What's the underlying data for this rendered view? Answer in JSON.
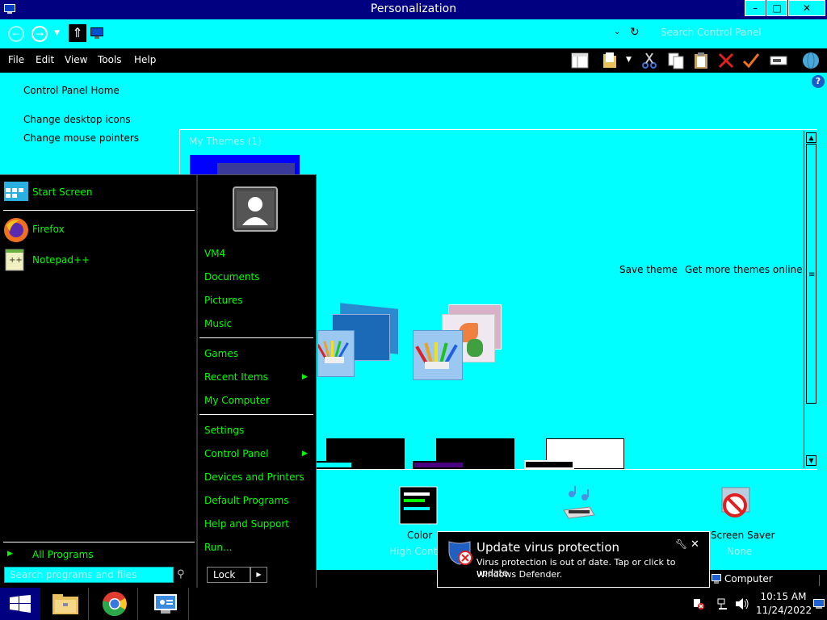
{
  "window": {
    "title": "Personalization",
    "minimize": "–",
    "maximize": "□",
    "close": "✕"
  },
  "address": {
    "search_placeholder": "Search Control Panel"
  },
  "menu": {
    "file": "File",
    "edit": "Edit",
    "view": "View",
    "tools": "Tools",
    "help": "Help"
  },
  "left_pane": {
    "home": "Control Panel Home",
    "desktop_icons": "Change desktop icons",
    "mouse_pointers": "Change mouse pointers"
  },
  "themes": {
    "my_themes": "My Themes (1)",
    "save_theme": "Save theme",
    "get_more": "Get more themes online"
  },
  "bottom_items": {
    "color_label": "Color",
    "color_sub": "High Contrast",
    "screensaver_label": "Screen Saver",
    "screensaver_sub": "None",
    "computer": "Computer"
  },
  "start_menu": {
    "left_items": [
      {
        "label": "Start Screen"
      },
      {
        "label": "Firefox"
      },
      {
        "label": "Notepad++"
      }
    ],
    "all_programs": "All Programs",
    "search_placeholder": "Search programs and files",
    "right_items": {
      "user": "VM4",
      "documents": "Documents",
      "pictures": "Pictures",
      "music": "Music",
      "games": "Games",
      "recent": "Recent Items",
      "computer": "My Computer",
      "settings": "Settings",
      "control_panel": "Control Panel",
      "devices": "Devices and Printers",
      "default_programs": "Default Programs",
      "help": "Help and Support",
      "run": "Run..."
    },
    "lock": "Lock"
  },
  "notification": {
    "title": "Update virus protection",
    "line1": "Virus protection is out of date. Tap or click to update",
    "line2": "Windows Defender."
  },
  "taskbar": {
    "time": "10:15 AM",
    "date": "11/24/2022"
  },
  "colors": {
    "bg": "#00FFFF",
    "title_bar": "#000080",
    "start_text": "#00FF00"
  }
}
